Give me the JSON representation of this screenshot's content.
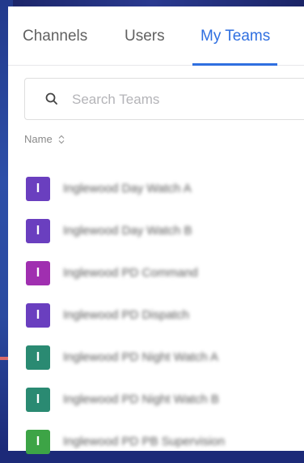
{
  "tabs": [
    {
      "label": "Channels",
      "active": false
    },
    {
      "label": "Users",
      "active": false
    },
    {
      "label": "My Teams",
      "active": true
    }
  ],
  "search": {
    "placeholder": "Search Teams",
    "value": ""
  },
  "list_header": {
    "label": "Name"
  },
  "teams": [
    {
      "initial": "I",
      "name": "Inglewood Day Watch A",
      "color": "#6a3fbf"
    },
    {
      "initial": "I",
      "name": "Inglewood Day Watch B",
      "color": "#6a3fbf"
    },
    {
      "initial": "I",
      "name": "Inglewood PD Command",
      "color": "#a02fb0"
    },
    {
      "initial": "I",
      "name": "Inglewood PD Dispatch",
      "color": "#6a3fbf"
    },
    {
      "initial": "I",
      "name": "Inglewood PD Night Watch A",
      "color": "#2a8a72"
    },
    {
      "initial": "I",
      "name": "Inglewood PD Night Watch B",
      "color": "#2a8a72"
    },
    {
      "initial": "I",
      "name": "Inglewood PD PB Supervision",
      "color": "#3da446"
    }
  ],
  "colors": {
    "accent": "#2f6fe0"
  }
}
